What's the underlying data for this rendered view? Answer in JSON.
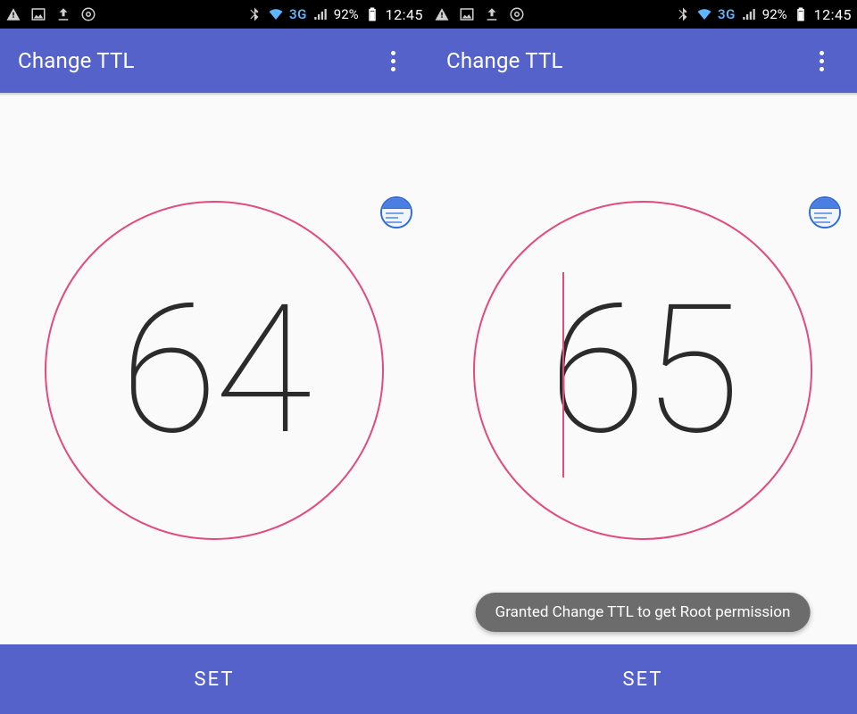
{
  "colors": {
    "primary": "#5562c9",
    "accent_circle": "#e24a80",
    "statusbar_bg": "#000000",
    "network_label": "#5fb6ff"
  },
  "statusbar": {
    "network_label": "3G",
    "battery_text": "92%",
    "time": "12:45",
    "left_icons": [
      "warning-icon",
      "image-icon",
      "upload-icon",
      "settings-icon"
    ],
    "right_icons": [
      "bluetooth-icon",
      "wifi-icon",
      "network-3g-label",
      "signal-icon",
      "battery-icon"
    ]
  },
  "appbar": {
    "title": "Change TTL",
    "overflow": "more-options"
  },
  "screens": [
    {
      "ttl_value": "64",
      "cursor_visible": false,
      "button_label": "SET",
      "toast": null
    },
    {
      "ttl_value": "65",
      "cursor_visible": true,
      "button_label": "SET",
      "toast": "Granted Change TTL to get Root permission"
    }
  ]
}
